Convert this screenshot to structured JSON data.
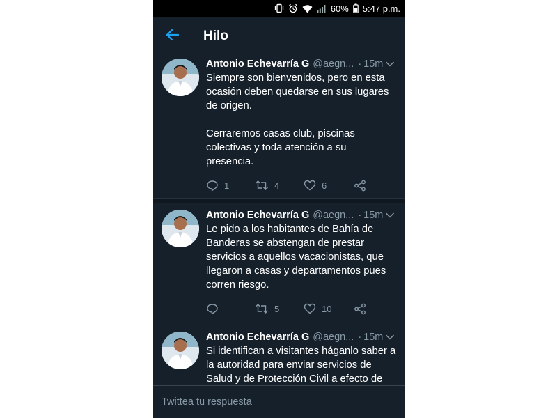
{
  "status_bar": {
    "battery": "60%",
    "time": "5:47 p.m."
  },
  "header": {
    "title": "Hilo"
  },
  "tweets": [
    {
      "name": "Antonio Echevarría G",
      "handle": "@aegn...",
      "dot": "·",
      "time": "15m",
      "text": "Siempre son bienvenidos, pero en esta ocasión deben quedarse en sus lugares de origen.\n\nCerraremos casas club, piscinas colectivas y toda atención a su presencia.",
      "replies": "1",
      "retweets": "4",
      "likes": "6"
    },
    {
      "name": "Antonio Echevarría G",
      "handle": "@aegn...",
      "dot": "·",
      "time": "15m",
      "text": "Le pido a los habitantes de Bahía de Banderas se abstengan de prestar servicios a aquellos vacacionistas, que llegaron a casas y departamentos pues corren riesgo.",
      "replies": "",
      "retweets": "5",
      "likes": "10"
    },
    {
      "name": "Antonio Echevarría G",
      "handle": "@aegn...",
      "dot": "·",
      "time": "15m",
      "text": "Si identifican a visitantes háganlo saber a la autoridad para enviar servicios de Salud y de Protección Civil a efecto de garantizar su aislamiento."
    }
  ],
  "composer": {
    "placeholder": "Twittea tu respuesta"
  },
  "colors": {
    "background": "#15202b",
    "accent": "#1da1f2",
    "secondary_text": "#8899a6"
  },
  "icons": [
    "vibrate-icon",
    "alarm-icon",
    "wifi-icon",
    "signal-icon",
    "battery-icon",
    "back-arrow-icon",
    "chevron-down-icon",
    "reply-icon",
    "retweet-icon",
    "like-icon",
    "share-icon"
  ]
}
